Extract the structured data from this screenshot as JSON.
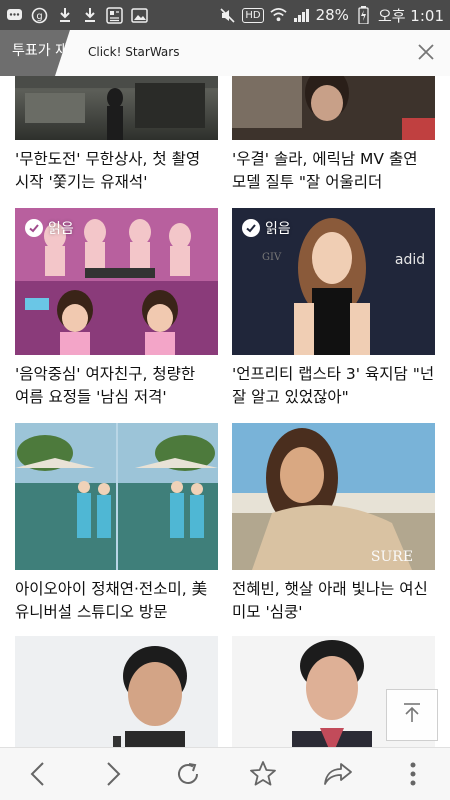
{
  "status": {
    "battery": "28%",
    "time": "오후 1:01",
    "network": "HD"
  },
  "tabs": {
    "previous_label": "투표가 재",
    "active_title": "Click! StarWars"
  },
  "articles": [
    {
      "caption": "'무한도전' 무한상사, 첫 촬영 시작 '쫓기는 유재석'",
      "read": false
    },
    {
      "caption": "'우결' 솔라, 에릭남 MV 출연 모델 질투 \"잘 어울리더",
      "read": false
    },
    {
      "caption": "'음악중심' 여자친구, 청량한 여름 요정들 '남심 저격'",
      "read": true
    },
    {
      "caption": "'언프리티 랩스타 3' 육지담 \"넌 잘 알고 있었잖아\"",
      "read": true
    },
    {
      "caption": "아이오아이 정채연·전소미, 美 유니버설 스튜디오 방문",
      "read": false
    },
    {
      "caption": "전혜빈, 햇살 아래 빛나는 여신 미모 '심쿵'",
      "read": false
    },
    {
      "caption": "",
      "read": false
    },
    {
      "caption": "",
      "read": false
    }
  ],
  "badges": {
    "read_label": "읽음"
  },
  "thumb_text": {
    "ad_brand": "adid",
    "mag": "SURE"
  },
  "colors": {
    "statusbar": "#4a4a4a",
    "tab_prev": "#6e6e6e",
    "read_badge": "#ffffff"
  }
}
